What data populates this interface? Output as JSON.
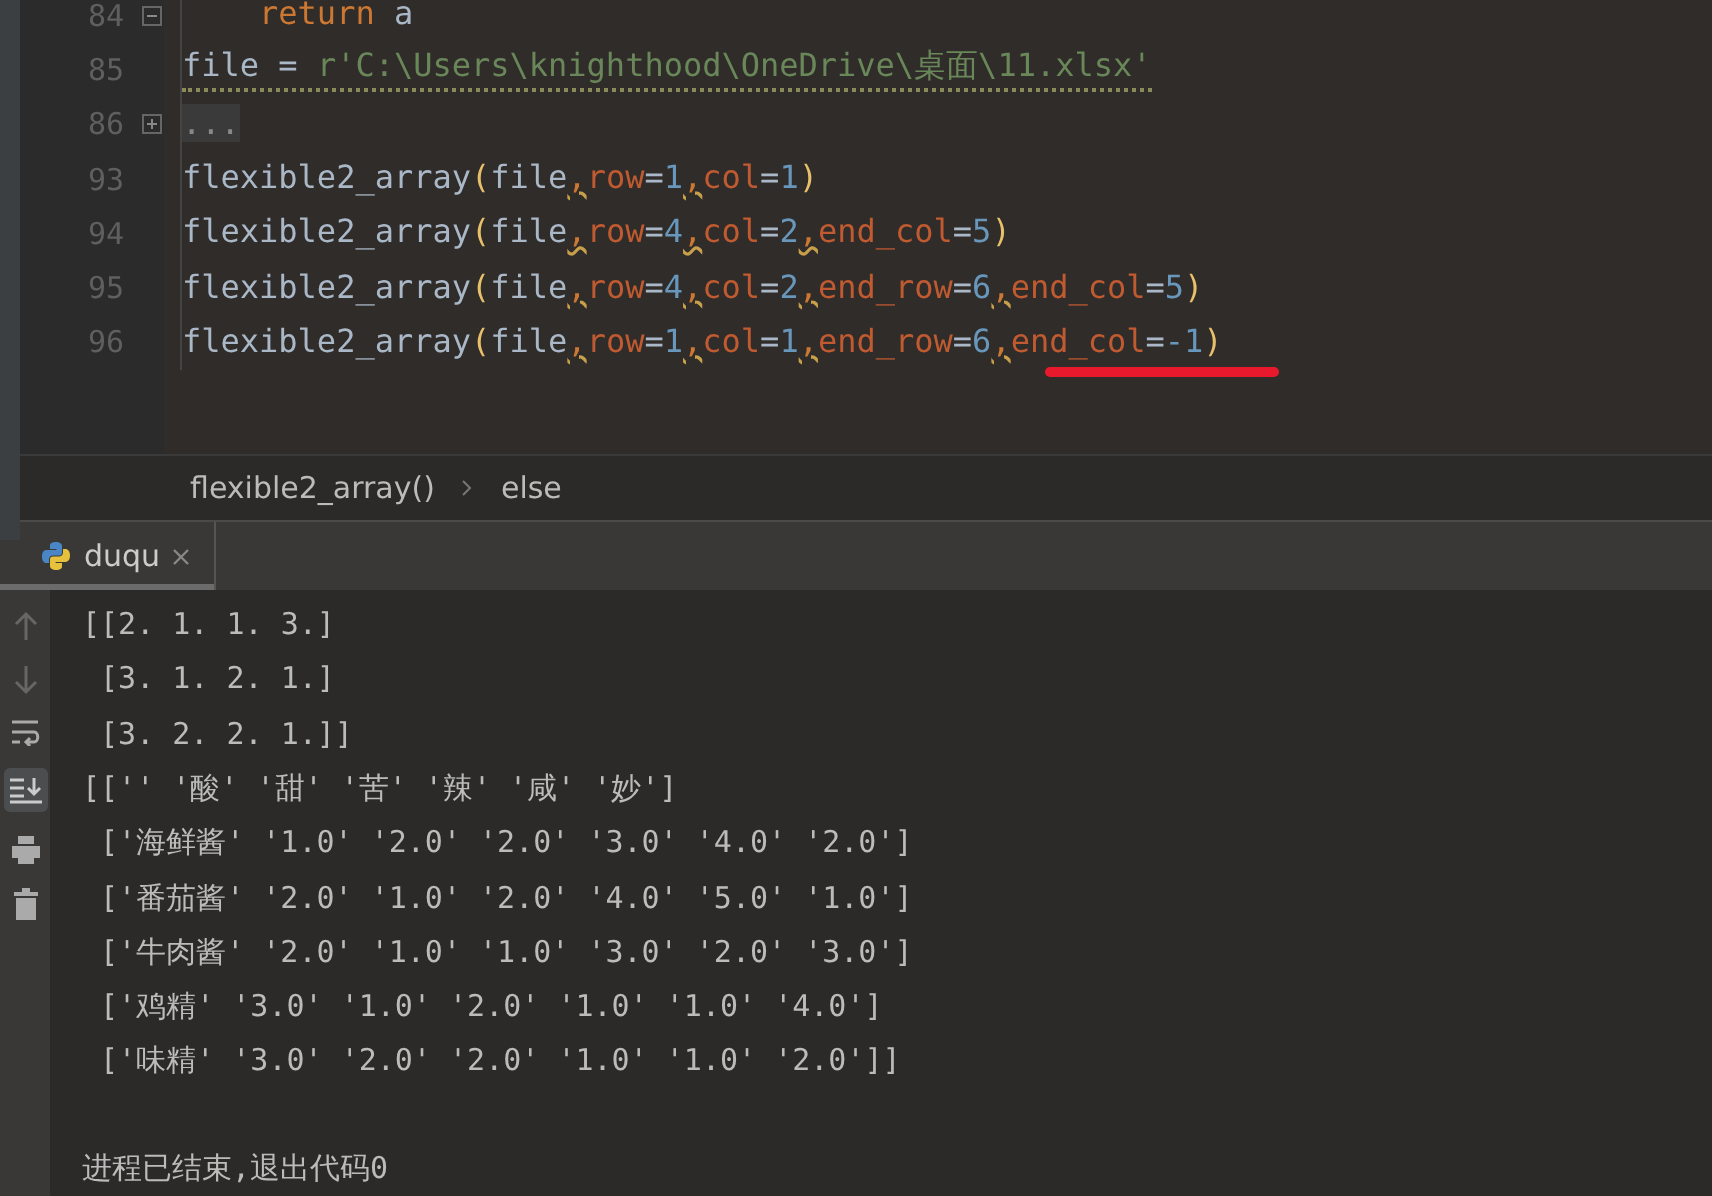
{
  "editor": {
    "lines": [
      {
        "number": "84",
        "foldable": true,
        "expanded": true,
        "warning": false,
        "tokens": [
          {
            "kind": "keyword",
            "text": "    return"
          },
          {
            "kind": "plain",
            "text": " a"
          }
        ]
      },
      {
        "number": "85",
        "warning": true,
        "tokens": [
          {
            "kind": "plain",
            "text": "file = "
          },
          {
            "kind": "string",
            "text": "r'C:\\Users\\knighthood\\OneDrive\\桌面\\11.xlsx'"
          }
        ]
      },
      {
        "number": "86",
        "foldable": true,
        "expanded": false,
        "warning": false,
        "tokens": [
          {
            "kind": "folded",
            "text": "..."
          }
        ]
      },
      {
        "number": "93",
        "warning": false,
        "tokens": [
          {
            "kind": "plain",
            "text": "flexible2_array"
          },
          {
            "kind": "paren",
            "text": "("
          },
          {
            "kind": "plain",
            "text": "file"
          },
          {
            "kind": "comma",
            "text": ","
          },
          {
            "kind": "param",
            "text": "row"
          },
          {
            "kind": "plain",
            "text": "="
          },
          {
            "kind": "number",
            "text": "1"
          },
          {
            "kind": "comma",
            "text": ","
          },
          {
            "kind": "param",
            "text": "col"
          },
          {
            "kind": "plain",
            "text": "="
          },
          {
            "kind": "number",
            "text": "1"
          },
          {
            "kind": "paren",
            "text": ")"
          }
        ]
      },
      {
        "number": "94",
        "warning": false,
        "tokens": [
          {
            "kind": "plain",
            "text": "flexible2_array"
          },
          {
            "kind": "paren",
            "text": "("
          },
          {
            "kind": "plain",
            "text": "file"
          },
          {
            "kind": "comma",
            "text": ","
          },
          {
            "kind": "param",
            "text": "row"
          },
          {
            "kind": "plain",
            "text": "="
          },
          {
            "kind": "number",
            "text": "4"
          },
          {
            "kind": "comma",
            "text": ","
          },
          {
            "kind": "param",
            "text": "col"
          },
          {
            "kind": "plain",
            "text": "="
          },
          {
            "kind": "number",
            "text": "2"
          },
          {
            "kind": "comma",
            "text": ","
          },
          {
            "kind": "param",
            "text": "end_col"
          },
          {
            "kind": "plain",
            "text": "="
          },
          {
            "kind": "number",
            "text": "5"
          },
          {
            "kind": "paren",
            "text": ")"
          }
        ]
      },
      {
        "number": "95",
        "warning": false,
        "tokens": [
          {
            "kind": "plain",
            "text": "flexible2_array"
          },
          {
            "kind": "paren",
            "text": "("
          },
          {
            "kind": "plain",
            "text": "file"
          },
          {
            "kind": "comma",
            "text": ","
          },
          {
            "kind": "param",
            "text": "row"
          },
          {
            "kind": "plain",
            "text": "="
          },
          {
            "kind": "number",
            "text": "4"
          },
          {
            "kind": "comma",
            "text": ","
          },
          {
            "kind": "param",
            "text": "col"
          },
          {
            "kind": "plain",
            "text": "="
          },
          {
            "kind": "number",
            "text": "2"
          },
          {
            "kind": "comma",
            "text": ","
          },
          {
            "kind": "param",
            "text": "end_row"
          },
          {
            "kind": "plain",
            "text": "="
          },
          {
            "kind": "number",
            "text": "6"
          },
          {
            "kind": "comma",
            "text": ","
          },
          {
            "kind": "param",
            "text": "end_col"
          },
          {
            "kind": "plain",
            "text": "="
          },
          {
            "kind": "number",
            "text": "5"
          },
          {
            "kind": "paren",
            "text": ")"
          }
        ]
      },
      {
        "number": "96",
        "warning": false,
        "tokens": [
          {
            "kind": "plain",
            "text": "flexible2_array"
          },
          {
            "kind": "paren",
            "text": "("
          },
          {
            "kind": "plain",
            "text": "file"
          },
          {
            "kind": "comma",
            "text": ","
          },
          {
            "kind": "param",
            "text": "row"
          },
          {
            "kind": "plain",
            "text": "="
          },
          {
            "kind": "number",
            "text": "1"
          },
          {
            "kind": "comma",
            "text": ","
          },
          {
            "kind": "param",
            "text": "col"
          },
          {
            "kind": "plain",
            "text": "="
          },
          {
            "kind": "number",
            "text": "1"
          },
          {
            "kind": "comma",
            "text": ","
          },
          {
            "kind": "param",
            "text": "end_row"
          },
          {
            "kind": "plain",
            "text": "="
          },
          {
            "kind": "number",
            "text": "6"
          },
          {
            "kind": "comma",
            "text": ","
          },
          {
            "kind": "param",
            "text": "end_col"
          },
          {
            "kind": "plain",
            "text": "="
          },
          {
            "kind": "number",
            "text": "-1"
          },
          {
            "kind": "paren",
            "text": ")"
          }
        ]
      }
    ]
  },
  "breadcrumb": [
    "flexible2_array()",
    "else"
  ],
  "run_tabs": [
    {
      "label": "duqu",
      "selected": true
    }
  ],
  "console": {
    "lines": [
      "[[2. 1. 1. 3.]",
      " [3. 1. 2. 1.]",
      " [3. 2. 2. 1.]]",
      "[['' '酸' '甜' '苦' '辣' '咸' '妙']",
      " ['海鲜酱' '1.0' '2.0' '2.0' '3.0' '4.0' '2.0']",
      " ['番茄酱' '2.0' '1.0' '2.0' '4.0' '5.0' '1.0']",
      " ['牛肉酱' '2.0' '1.0' '1.0' '3.0' '2.0' '3.0']",
      " ['鸡精' '3.0' '1.0' '2.0' '1.0' '1.0' '4.0']",
      " ['味精' '3.0' '2.0' '2.0' '1.0' '1.0' '2.0']]",
      "进程已结束,退出代码0"
    ]
  }
}
